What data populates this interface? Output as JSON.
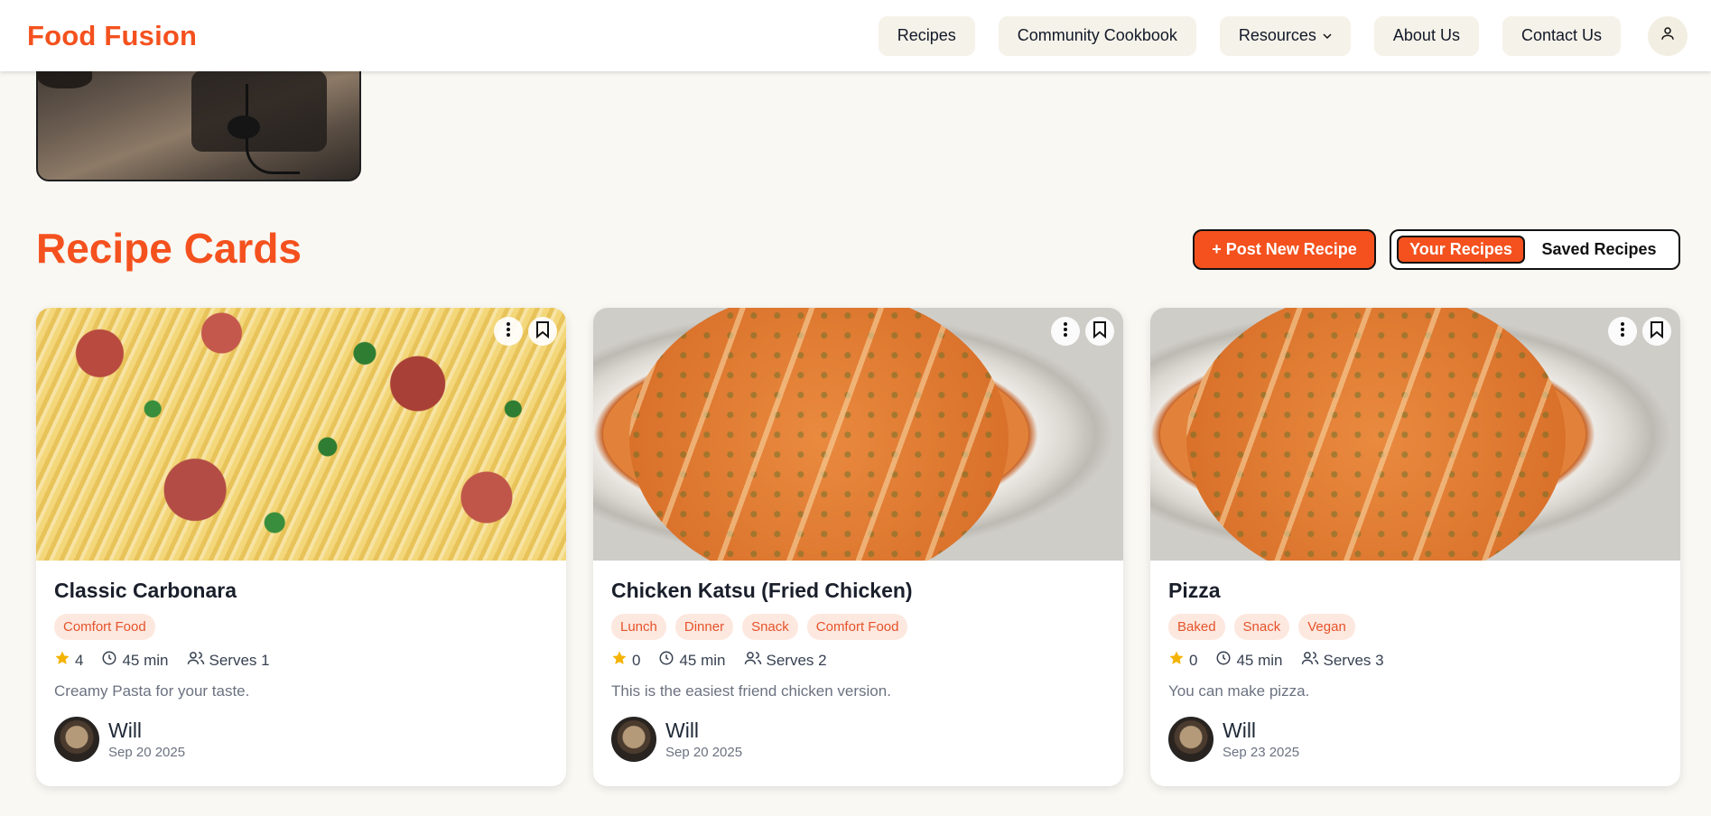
{
  "header": {
    "brand": "Food Fusion",
    "nav": [
      "Recipes",
      "Community Cookbook",
      "Resources",
      "About Us",
      "Contact Us"
    ]
  },
  "section": {
    "title": "Recipe Cards",
    "post_button": "+ Post New Recipe",
    "toggle": {
      "active": "Your Recipes",
      "inactive": "Saved Recipes"
    }
  },
  "cards": [
    {
      "title": "Classic Carbonara",
      "tags": [
        "Comfort Food"
      ],
      "rating": "4",
      "time": "45 min",
      "serves": "Serves 1",
      "description": "Creamy Pasta for your taste.",
      "author": "Will",
      "date": "Sep 20 2025"
    },
    {
      "title": "Chicken Katsu (Fried Chicken)",
      "tags": [
        "Lunch",
        "Dinner",
        "Snack",
        "Comfort Food"
      ],
      "rating": "0",
      "time": "45 min",
      "serves": "Serves 2",
      "description": "This is the easiest friend chicken version.",
      "author": "Will",
      "date": "Sep 20 2025"
    },
    {
      "title": "Pizza",
      "tags": [
        "Baked",
        "Snack",
        "Vegan"
      ],
      "rating": "0",
      "time": "45 min",
      "serves": "Serves 3",
      "description": "You can make pizza.",
      "author": "Will",
      "date": "Sep 23 2025"
    }
  ],
  "colors": {
    "accent": "#f4511e",
    "background": "#f9f8f3",
    "tag_bg": "#fde8df",
    "star": "#f5b301"
  }
}
